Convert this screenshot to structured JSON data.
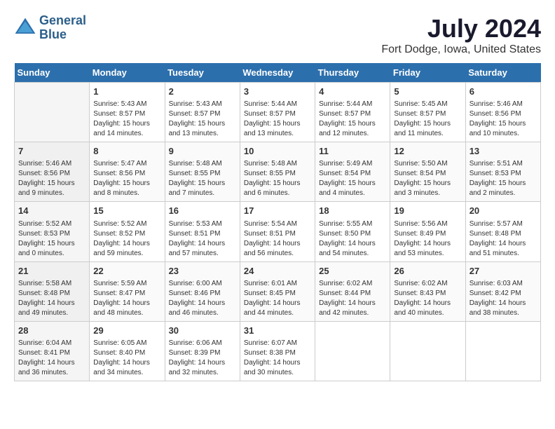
{
  "logo": {
    "line1": "General",
    "line2": "Blue"
  },
  "title": "July 2024",
  "subtitle": "Fort Dodge, Iowa, United States",
  "days_of_week": [
    "Sunday",
    "Monday",
    "Tuesday",
    "Wednesday",
    "Thursday",
    "Friday",
    "Saturday"
  ],
  "weeks": [
    [
      {
        "day": "",
        "sunrise": "",
        "sunset": "",
        "daylight": ""
      },
      {
        "day": "1",
        "sunrise": "Sunrise: 5:43 AM",
        "sunset": "Sunset: 8:57 PM",
        "daylight": "Daylight: 15 hours and 14 minutes."
      },
      {
        "day": "2",
        "sunrise": "Sunrise: 5:43 AM",
        "sunset": "Sunset: 8:57 PM",
        "daylight": "Daylight: 15 hours and 13 minutes."
      },
      {
        "day": "3",
        "sunrise": "Sunrise: 5:44 AM",
        "sunset": "Sunset: 8:57 PM",
        "daylight": "Daylight: 15 hours and 13 minutes."
      },
      {
        "day": "4",
        "sunrise": "Sunrise: 5:44 AM",
        "sunset": "Sunset: 8:57 PM",
        "daylight": "Daylight: 15 hours and 12 minutes."
      },
      {
        "day": "5",
        "sunrise": "Sunrise: 5:45 AM",
        "sunset": "Sunset: 8:57 PM",
        "daylight": "Daylight: 15 hours and 11 minutes."
      },
      {
        "day": "6",
        "sunrise": "Sunrise: 5:46 AM",
        "sunset": "Sunset: 8:56 PM",
        "daylight": "Daylight: 15 hours and 10 minutes."
      }
    ],
    [
      {
        "day": "7",
        "sunrise": "Sunrise: 5:46 AM",
        "sunset": "Sunset: 8:56 PM",
        "daylight": "Daylight: 15 hours and 9 minutes."
      },
      {
        "day": "8",
        "sunrise": "Sunrise: 5:47 AM",
        "sunset": "Sunset: 8:56 PM",
        "daylight": "Daylight: 15 hours and 8 minutes."
      },
      {
        "day": "9",
        "sunrise": "Sunrise: 5:48 AM",
        "sunset": "Sunset: 8:55 PM",
        "daylight": "Daylight: 15 hours and 7 minutes."
      },
      {
        "day": "10",
        "sunrise": "Sunrise: 5:48 AM",
        "sunset": "Sunset: 8:55 PM",
        "daylight": "Daylight: 15 hours and 6 minutes."
      },
      {
        "day": "11",
        "sunrise": "Sunrise: 5:49 AM",
        "sunset": "Sunset: 8:54 PM",
        "daylight": "Daylight: 15 hours and 4 minutes."
      },
      {
        "day": "12",
        "sunrise": "Sunrise: 5:50 AM",
        "sunset": "Sunset: 8:54 PM",
        "daylight": "Daylight: 15 hours and 3 minutes."
      },
      {
        "day": "13",
        "sunrise": "Sunrise: 5:51 AM",
        "sunset": "Sunset: 8:53 PM",
        "daylight": "Daylight: 15 hours and 2 minutes."
      }
    ],
    [
      {
        "day": "14",
        "sunrise": "Sunrise: 5:52 AM",
        "sunset": "Sunset: 8:53 PM",
        "daylight": "Daylight: 15 hours and 0 minutes."
      },
      {
        "day": "15",
        "sunrise": "Sunrise: 5:52 AM",
        "sunset": "Sunset: 8:52 PM",
        "daylight": "Daylight: 14 hours and 59 minutes."
      },
      {
        "day": "16",
        "sunrise": "Sunrise: 5:53 AM",
        "sunset": "Sunset: 8:51 PM",
        "daylight": "Daylight: 14 hours and 57 minutes."
      },
      {
        "day": "17",
        "sunrise": "Sunrise: 5:54 AM",
        "sunset": "Sunset: 8:51 PM",
        "daylight": "Daylight: 14 hours and 56 minutes."
      },
      {
        "day": "18",
        "sunrise": "Sunrise: 5:55 AM",
        "sunset": "Sunset: 8:50 PM",
        "daylight": "Daylight: 14 hours and 54 minutes."
      },
      {
        "day": "19",
        "sunrise": "Sunrise: 5:56 AM",
        "sunset": "Sunset: 8:49 PM",
        "daylight": "Daylight: 14 hours and 53 minutes."
      },
      {
        "day": "20",
        "sunrise": "Sunrise: 5:57 AM",
        "sunset": "Sunset: 8:48 PM",
        "daylight": "Daylight: 14 hours and 51 minutes."
      }
    ],
    [
      {
        "day": "21",
        "sunrise": "Sunrise: 5:58 AM",
        "sunset": "Sunset: 8:48 PM",
        "daylight": "Daylight: 14 hours and 49 minutes."
      },
      {
        "day": "22",
        "sunrise": "Sunrise: 5:59 AM",
        "sunset": "Sunset: 8:47 PM",
        "daylight": "Daylight: 14 hours and 48 minutes."
      },
      {
        "day": "23",
        "sunrise": "Sunrise: 6:00 AM",
        "sunset": "Sunset: 8:46 PM",
        "daylight": "Daylight: 14 hours and 46 minutes."
      },
      {
        "day": "24",
        "sunrise": "Sunrise: 6:01 AM",
        "sunset": "Sunset: 8:45 PM",
        "daylight": "Daylight: 14 hours and 44 minutes."
      },
      {
        "day": "25",
        "sunrise": "Sunrise: 6:02 AM",
        "sunset": "Sunset: 8:44 PM",
        "daylight": "Daylight: 14 hours and 42 minutes."
      },
      {
        "day": "26",
        "sunrise": "Sunrise: 6:02 AM",
        "sunset": "Sunset: 8:43 PM",
        "daylight": "Daylight: 14 hours and 40 minutes."
      },
      {
        "day": "27",
        "sunrise": "Sunrise: 6:03 AM",
        "sunset": "Sunset: 8:42 PM",
        "daylight": "Daylight: 14 hours and 38 minutes."
      }
    ],
    [
      {
        "day": "28",
        "sunrise": "Sunrise: 6:04 AM",
        "sunset": "Sunset: 8:41 PM",
        "daylight": "Daylight: 14 hours and 36 minutes."
      },
      {
        "day": "29",
        "sunrise": "Sunrise: 6:05 AM",
        "sunset": "Sunset: 8:40 PM",
        "daylight": "Daylight: 14 hours and 34 minutes."
      },
      {
        "day": "30",
        "sunrise": "Sunrise: 6:06 AM",
        "sunset": "Sunset: 8:39 PM",
        "daylight": "Daylight: 14 hours and 32 minutes."
      },
      {
        "day": "31",
        "sunrise": "Sunrise: 6:07 AM",
        "sunset": "Sunset: 8:38 PM",
        "daylight": "Daylight: 14 hours and 30 minutes."
      },
      {
        "day": "",
        "sunrise": "",
        "sunset": "",
        "daylight": ""
      },
      {
        "day": "",
        "sunrise": "",
        "sunset": "",
        "daylight": ""
      },
      {
        "day": "",
        "sunrise": "",
        "sunset": "",
        "daylight": ""
      }
    ]
  ]
}
